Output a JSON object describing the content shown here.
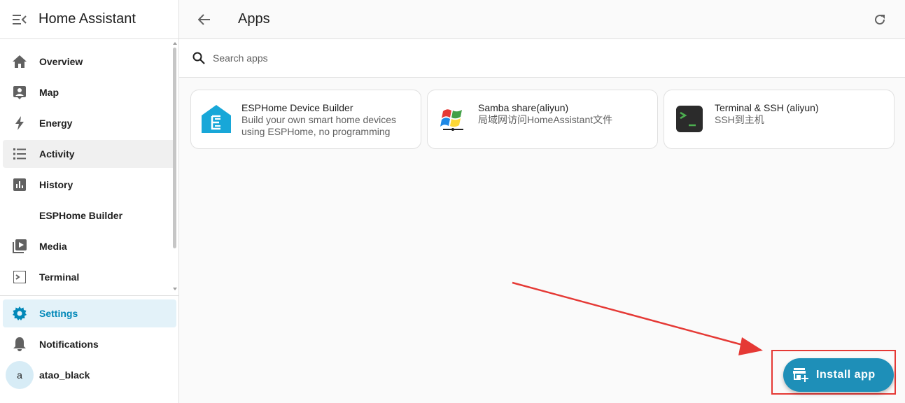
{
  "sidebar": {
    "title": "Home Assistant",
    "items": [
      {
        "label": "Overview",
        "icon": "home-icon"
      },
      {
        "label": "Map",
        "icon": "map-icon"
      },
      {
        "label": "Energy",
        "icon": "lightning-icon"
      },
      {
        "label": "Activity",
        "icon": "list-icon"
      },
      {
        "label": "History",
        "icon": "chart-bar-icon"
      },
      {
        "label": "ESPHome Builder",
        "icon": "none"
      },
      {
        "label": "Media",
        "icon": "media-play-icon"
      },
      {
        "label": "Terminal",
        "icon": "console-icon"
      }
    ],
    "bottom": {
      "settings": "Settings",
      "notifications": "Notifications",
      "user_initial": "a",
      "user_name": "atao_black"
    }
  },
  "header": {
    "title": "Apps"
  },
  "search": {
    "placeholder": "Search apps"
  },
  "apps": [
    {
      "name": "ESPHome Device Builder",
      "description": "Build your own smart home devices using ESPHome, no programming",
      "icon": "esphome-icon"
    },
    {
      "name": "Samba share(aliyun)",
      "description": "局域网访问HomeAssistant文件",
      "icon": "windows-flag-icon"
    },
    {
      "name": "Terminal & SSH (aliyun)",
      "description": "SSH到主机",
      "icon": "terminal-icon"
    }
  ],
  "fab": {
    "label": "Install app",
    "icon": "store-plus-icon"
  },
  "colors": {
    "accent": "#1e8fb8",
    "selected_bg": "#e3f2f9",
    "annotation": "#e53935"
  }
}
